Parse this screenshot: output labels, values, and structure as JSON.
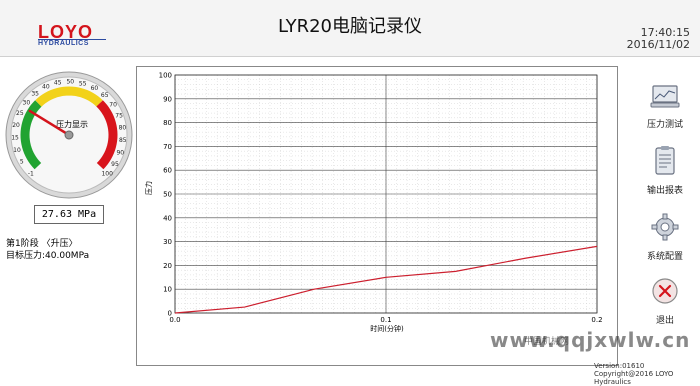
{
  "header": {
    "title": "LYR20电脑记录仪",
    "time": "17:40:15",
    "date": "2016/11/02",
    "logo_main": "LOYO",
    "logo_sub": "HYDRAULICS"
  },
  "gauge": {
    "title": "压力显示",
    "min": -1,
    "max": 100,
    "value": 27.63,
    "ticks": [
      "-1",
      "5",
      "10",
      "15",
      "20",
      "25",
      "30",
      "35",
      "40",
      "45",
      "50",
      "55",
      "60",
      "65",
      "70",
      "75",
      "80",
      "85",
      "90",
      "95",
      "100"
    ],
    "colors": {
      "green": "#21a331",
      "yellow": "#f2d21a",
      "red": "#d8141c",
      "needle": "#d4141c"
    }
  },
  "reading": {
    "value": "27.63",
    "unit": "MPa"
  },
  "stage": {
    "label": "第1阶段 〈升压〉",
    "target": "目标压力:40.00MPa"
  },
  "chart_data": {
    "type": "line",
    "xlabel": "时间(分钟)",
    "ylabel": "压力",
    "xlim": [
      0,
      0.2
    ],
    "ylim": [
      0,
      100
    ],
    "x_ticks": [
      "0.0",
      "0.1",
      "0.2"
    ],
    "y_ticks": [
      "0",
      "10",
      "20",
      "30",
      "40",
      "50",
      "60",
      "70",
      "80",
      "90",
      "100"
    ],
    "grid": true,
    "series": [
      {
        "color": "#cc1f2e",
        "x": [
          0,
          0.033,
          0.066,
          0.1,
          0.133,
          0.166,
          0.2
        ],
        "y": [
          0,
          2.5,
          10,
          15,
          17.5,
          23,
          28
        ]
      }
    ]
  },
  "sidebar": {
    "items": [
      {
        "label": "压力测试",
        "icon": "monitor-icon"
      },
      {
        "label": "输出报表",
        "icon": "report-icon"
      },
      {
        "label": "系统配置",
        "icon": "gear-icon"
      },
      {
        "label": "退出",
        "icon": "exit-icon"
      }
    ]
  },
  "footer": {
    "version": "Version:01610",
    "copyright": "Copyright@2016 LOYO Hydraulics"
  },
  "watermark": {
    "text": "www.qqjxwlw.cn",
    "sub": "中国机械网"
  }
}
